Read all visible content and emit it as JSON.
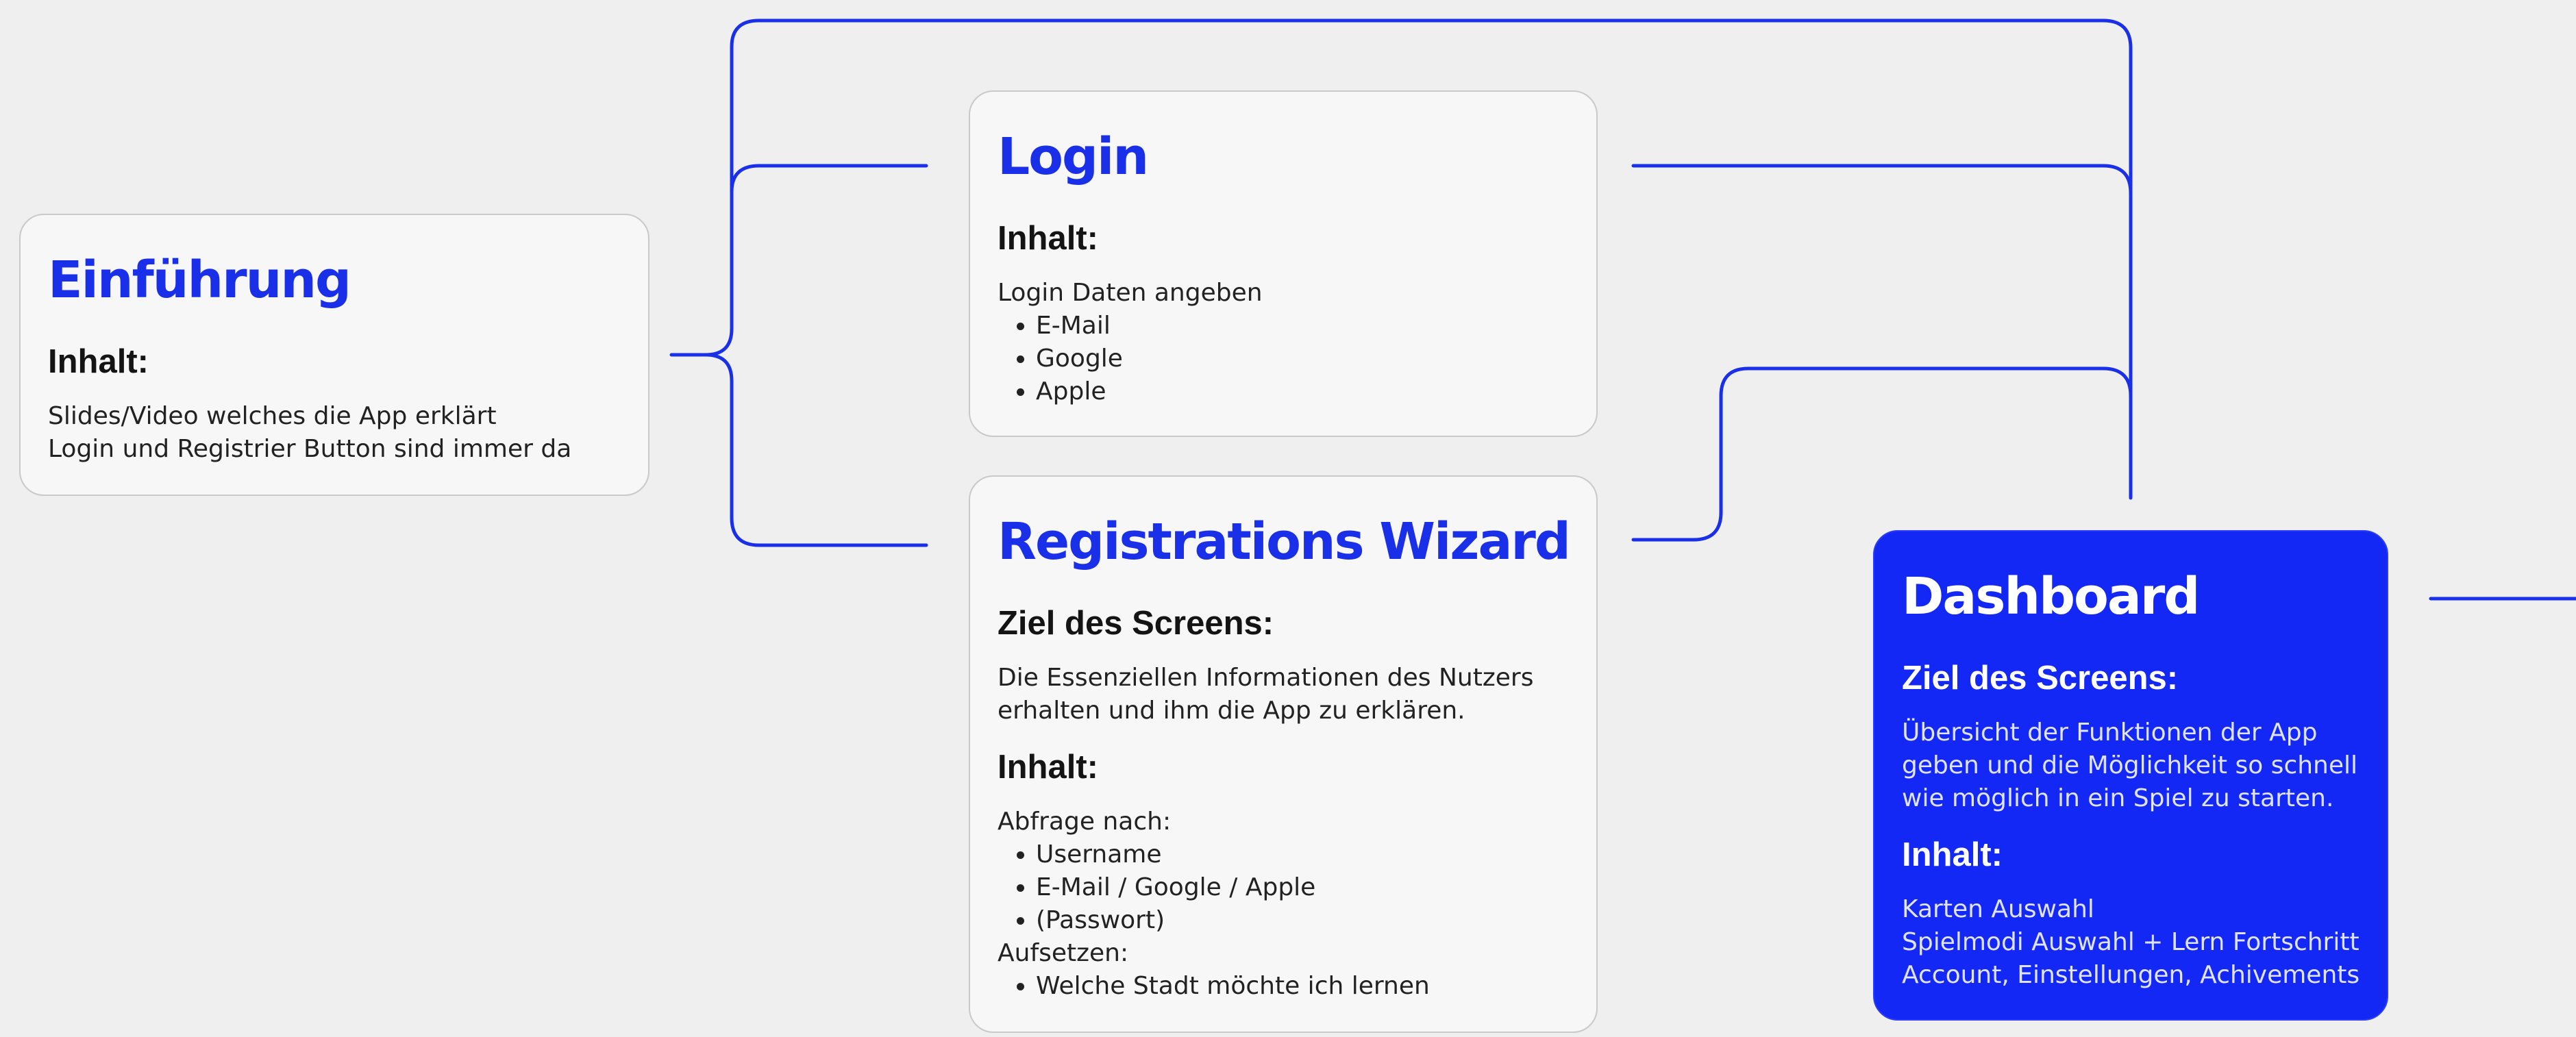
{
  "colors": {
    "accent": "#1a30e8",
    "accent_fill": "#1428f5",
    "card_bg": "#f7f7f7",
    "page_bg": "#efefef"
  },
  "einfuehrung": {
    "title": "Einführung",
    "content_heading": "Inhalt:",
    "lines": [
      "Slides/Video welches die App erklärt",
      "Login und Registrier Button sind immer da"
    ]
  },
  "login": {
    "title": "Login",
    "content_heading": "Inhalt:",
    "intro": "Login Daten angeben",
    "items": [
      "E-Mail",
      "Google",
      "Apple"
    ]
  },
  "registration": {
    "title": "Registrations Wizard",
    "goal_heading": "Ziel des Screens:",
    "goal_lines": [
      "Die Essenziellen Informationen des Nutzers",
      "erhalten und ihm die App zu erklären."
    ],
    "content_heading": "Inhalt:",
    "query_label": "Abfrage nach:",
    "query_items": [
      "Username",
      "E-Mail / Google / Apple",
      "(Passwort)"
    ],
    "setup_label": "Aufsetzen:",
    "setup_items": [
      "Welche Stadt möchte ich lernen"
    ]
  },
  "dashboard": {
    "title": "Dashboard",
    "goal_heading": "Ziel des Screens:",
    "goal_lines": [
      "Übersicht der Funktionen der App",
      "geben und die Möglichkeit so schnell",
      "wie möglich in ein Spiel zu starten."
    ],
    "content_heading": "Inhalt:",
    "content_lines": [
      "Karten Auswahl",
      "Spielmodi Auswahl + Lern Fortschritt",
      "Account, Einstellungen, Achivements"
    ]
  }
}
